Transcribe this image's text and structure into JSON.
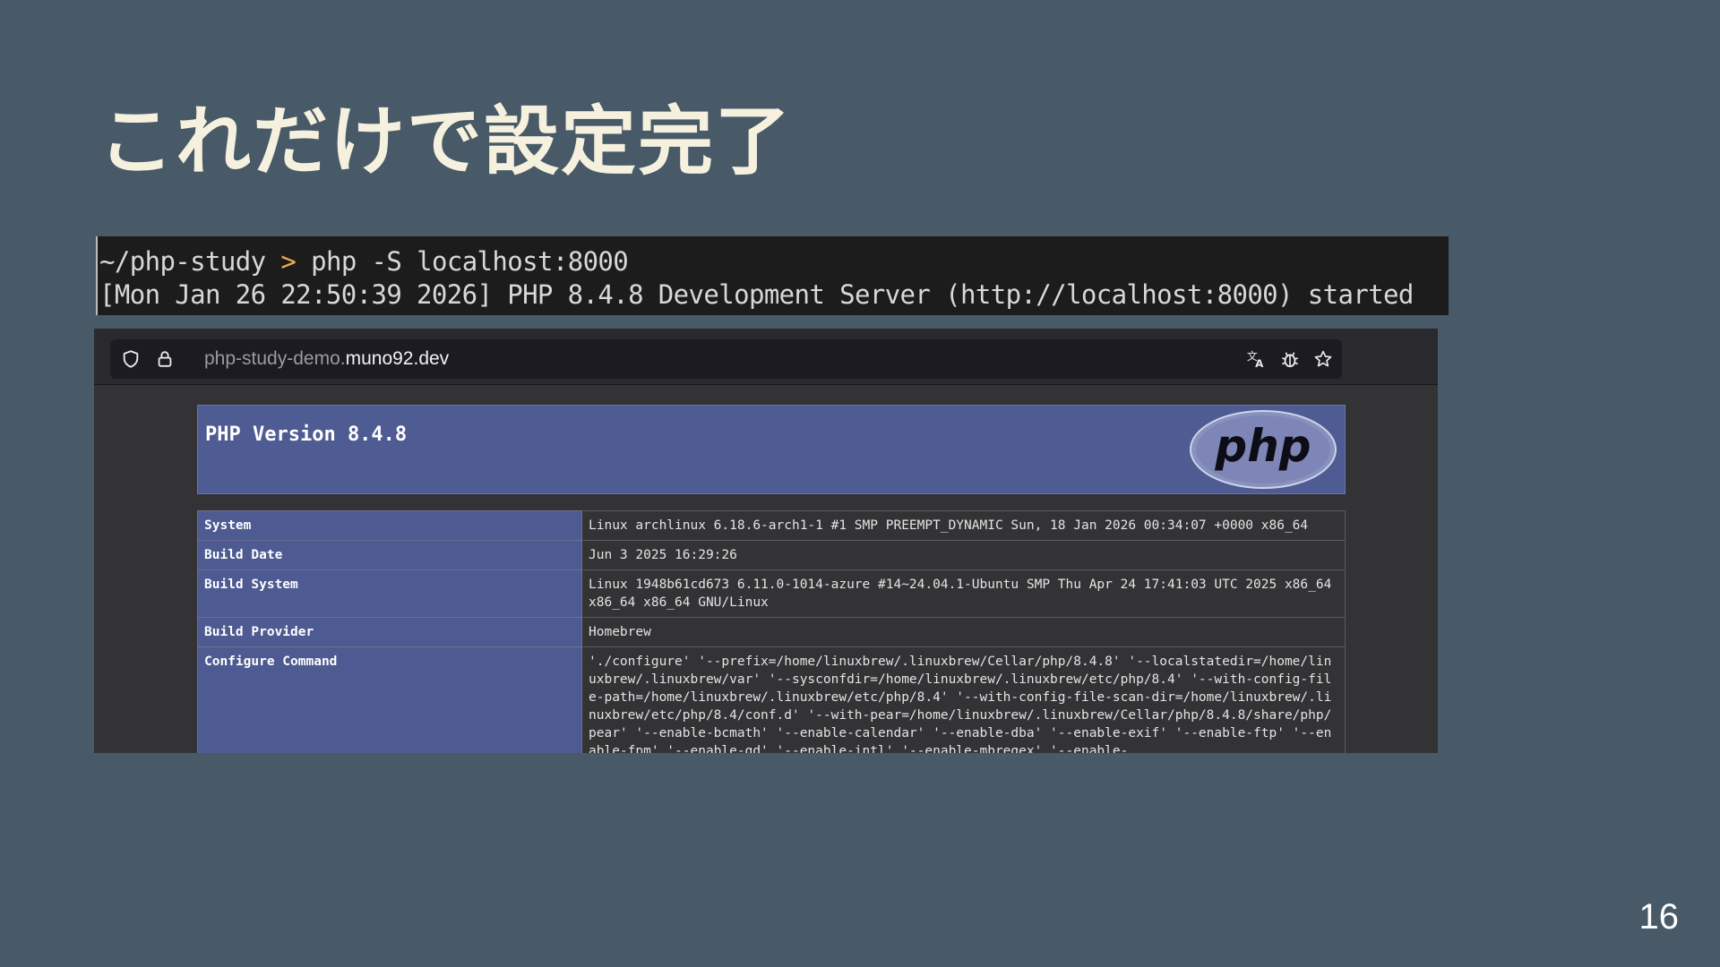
{
  "slide": {
    "title": "これだけで設定完了",
    "page_number": "16"
  },
  "terminal": {
    "prompt_dir": "~/php-study",
    "prompt_arrow": ">",
    "command": "php -S localhost:8000",
    "output_line": "[Mon Jan 26 22:50:39 2026] PHP 8.4.8 Development Server (http://localhost:8000) started"
  },
  "browser": {
    "url_subdomain": "php-study-demo.",
    "url_domain": "muno92.dev",
    "icons": [
      "shield-icon",
      "lock-icon",
      "translate-icon",
      "bug-icon",
      "star-icon"
    ]
  },
  "phpinfo": {
    "version_title": "PHP Version 8.4.8",
    "logo_text": "php",
    "rows": [
      {
        "key": "System",
        "value": "Linux archlinux 6.18.6-arch1-1 #1 SMP PREEMPT_DYNAMIC Sun, 18 Jan 2026 00:34:07 +0000 x86_64"
      },
      {
        "key": "Build Date",
        "value": "Jun 3 2025 16:29:26"
      },
      {
        "key": "Build System",
        "value": "Linux 1948b61cd673 6.11.0-1014-azure #14~24.04.1-Ubuntu SMP Thu Apr 24 17:41:03 UTC 2025 x86_64 x86_64 x86_64 GNU/Linux"
      },
      {
        "key": "Build Provider",
        "value": "Homebrew"
      },
      {
        "key": "Configure Command",
        "value": "'./configure' '--prefix=/home/linuxbrew/.linuxbrew/Cellar/php/8.4.8' '--localstatedir=/home/linuxbrew/.linuxbrew/var' '--sysconfdir=/home/linuxbrew/.linuxbrew/etc/php/8.4' '--with-config-file-path=/home/linuxbrew/.linuxbrew/etc/php/8.4' '--with-config-file-scan-dir=/home/linuxbrew/.linuxbrew/etc/php/8.4/conf.d' '--with-pear=/home/linuxbrew/.linuxbrew/Cellar/php/8.4.8/share/php/pear' '--enable-bcmath' '--enable-calendar' '--enable-dba' '--enable-exif' '--enable-ftp' '--enable-fpm' '--enable-gd' '--enable-intl' '--enable-mbregex' '--enable-"
      }
    ]
  },
  "colors": {
    "slide_background": "#485a67",
    "title": "#f6f1df",
    "php_header": "#4f5b93",
    "php_key_cell": "#4e5a92",
    "terminal_bg": "#1c1c1c",
    "prompt_arrow": "#e7b04a"
  }
}
